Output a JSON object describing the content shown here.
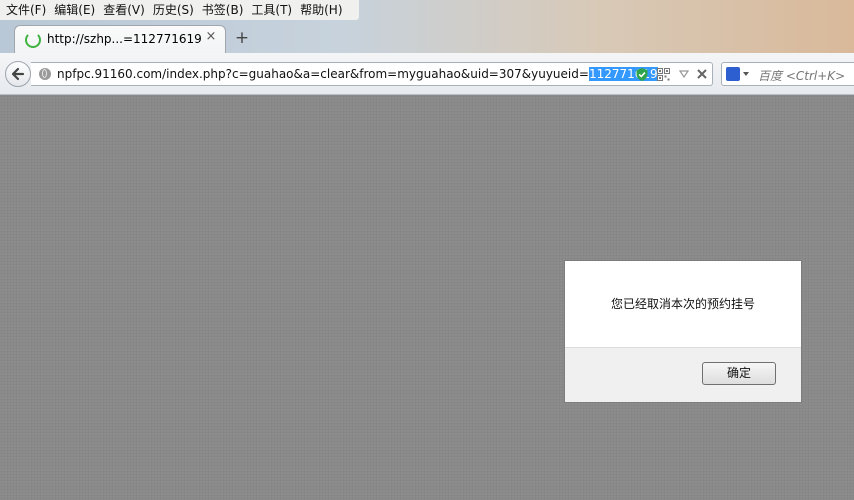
{
  "menubar": {
    "items": [
      "文件(F)",
      "编辑(E)",
      "查看(V)",
      "历史(S)",
      "书签(B)",
      "工具(T)",
      "帮助(H)"
    ]
  },
  "tab": {
    "title": "http://szhp...=112771619",
    "close_glyph": "×",
    "new_tab_glyph": "+",
    "status": "loading"
  },
  "address_bar": {
    "url_prefix": "npfpc.91160.com/index.php?c=guahao&a=clear&from=myguahao&uid=307&yuyueid=",
    "url_selected": "112771619",
    "icons": [
      "globe-icon",
      "shield-check-icon",
      "qr-code-icon",
      "dropdown-arrow-icon",
      "stop-icon"
    ]
  },
  "search_bar": {
    "placeholder": "百度 <Ctrl+K>",
    "engine_icon": "baidu-paw-icon"
  },
  "dialog": {
    "message": "您已经取消本次的预约挂号",
    "ok_label": "确定"
  },
  "colors": {
    "overlay": "#8c8c8c",
    "selection": "#3399ff",
    "shield": "#2ea44f",
    "spinner": "#3fb33f"
  }
}
